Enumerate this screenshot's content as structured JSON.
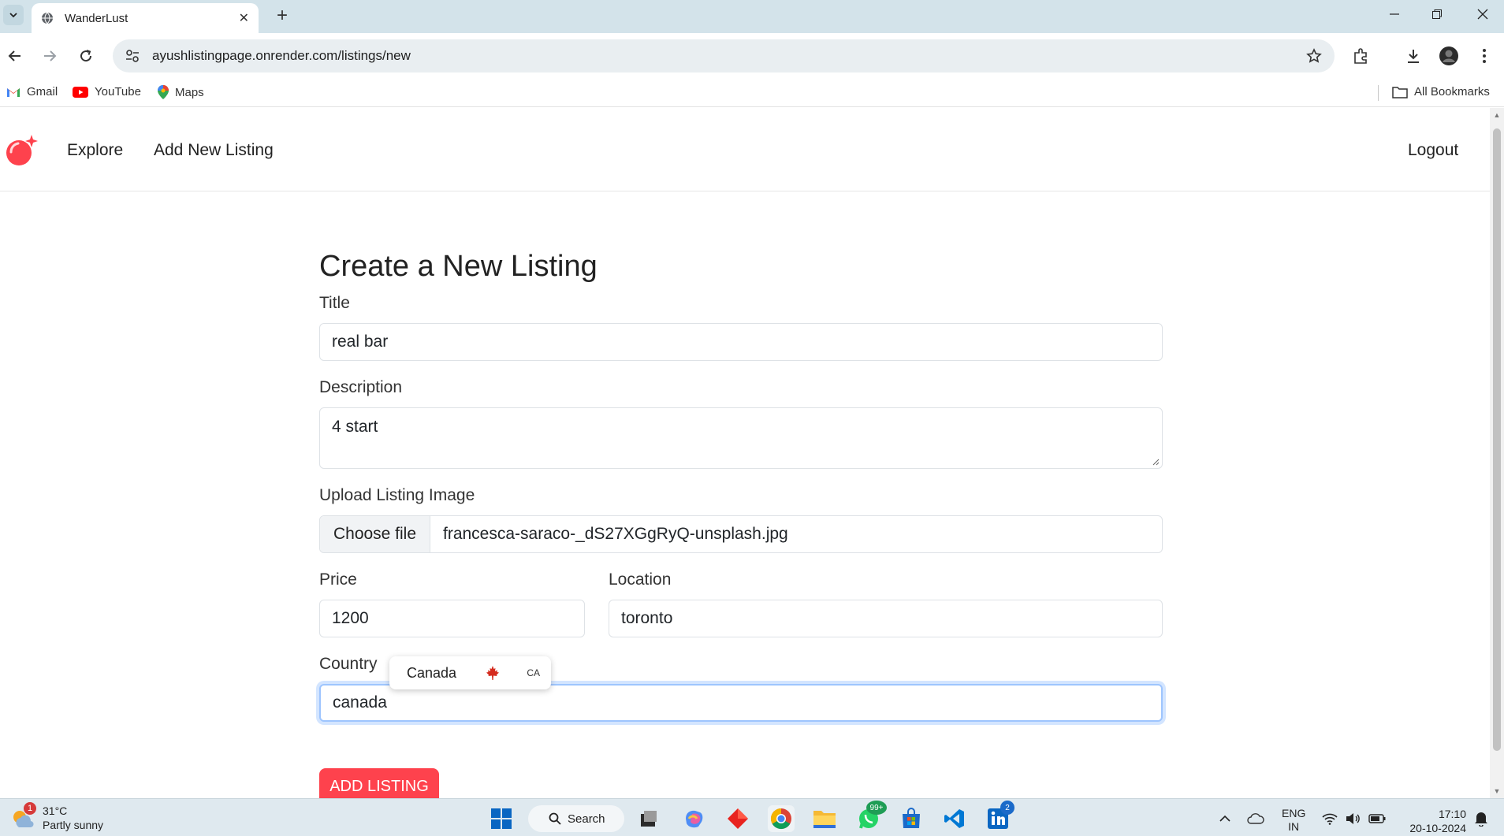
{
  "browser": {
    "tab_title": "WanderLust",
    "url": "ayushlistingpage.onrender.com/listings/new",
    "bookmarks": [
      {
        "label": "Gmail",
        "icon": "gmail-icon"
      },
      {
        "label": "YouTube",
        "icon": "youtube-icon"
      },
      {
        "label": "Maps",
        "icon": "maps-icon"
      }
    ],
    "all_bookmarks": "All Bookmarks"
  },
  "navbar": {
    "explore": "Explore",
    "add_new_listing": "Add New Listing",
    "logout": "Logout",
    "brand_color": "#fe424d"
  },
  "form": {
    "heading": "Create a New Listing",
    "title_label": "Title",
    "title_value": "real bar",
    "description_label": "Description",
    "description_value": "4 start",
    "image_label": "Upload Listing Image",
    "choose_file": "Choose file",
    "file_name": "francesca-saraco-_dS27XGgRyQ-unsplash.jpg",
    "price_label": "Price",
    "price_value": "1200",
    "location_label": "Location",
    "location_value": "toronto",
    "country_label": "Country",
    "country_value": "canada",
    "submit": "ADD LISTING"
  },
  "autocomplete": {
    "country": "Canada",
    "code": "CA"
  },
  "taskbar": {
    "temperature": "31°C",
    "weather": "Partly sunny",
    "weather_badge": "1",
    "search": "Search",
    "whatsapp_badge": "99+",
    "linkedin_badge": "2",
    "language": "ENG",
    "region": "IN",
    "time": "17:10",
    "date": "20-10-2024"
  }
}
